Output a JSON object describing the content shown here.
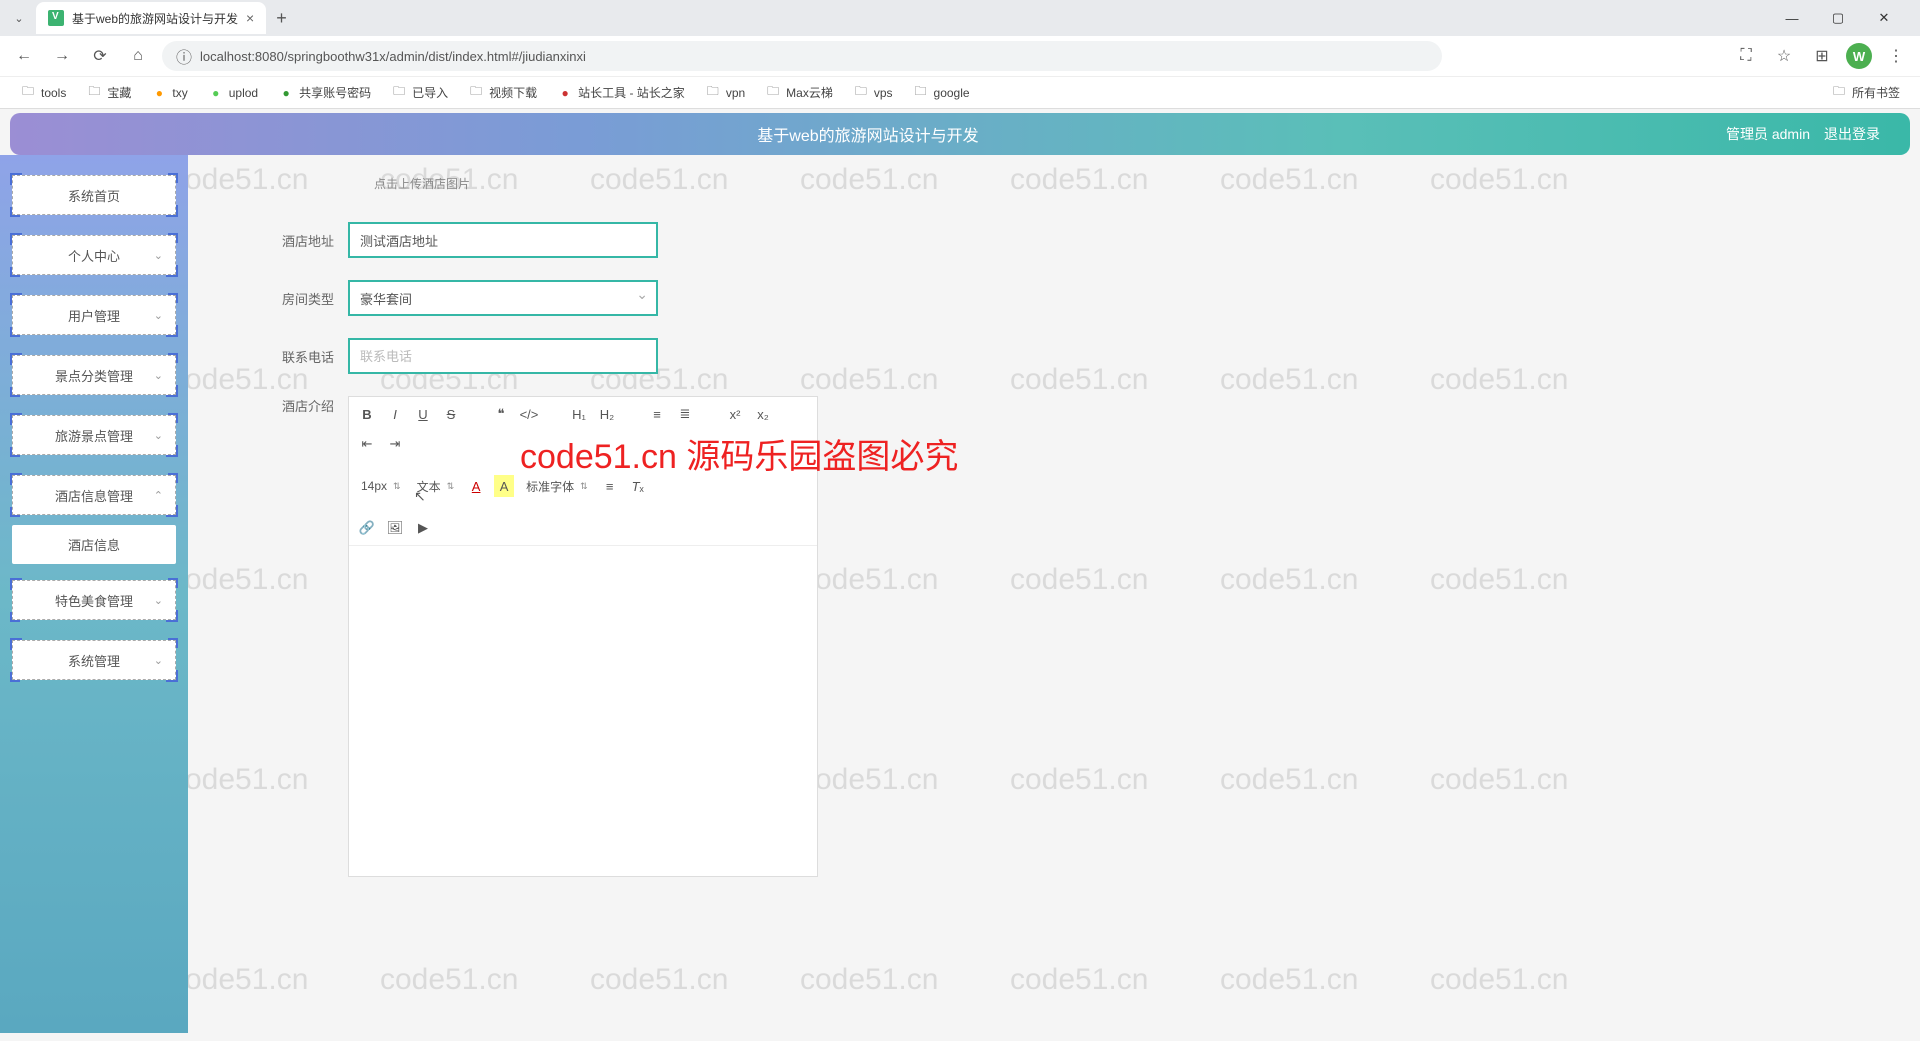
{
  "browser": {
    "tab_title": "基于web的旅游网站设计与开发",
    "url": "localhost:8080/springboothw31x/admin/dist/index.html#/jiudianxinxi",
    "avatar_letter": "W",
    "all_bookmarks": "所有书签"
  },
  "bookmarks": [
    {
      "label": "tools",
      "type": "folder"
    },
    {
      "label": "宝藏",
      "type": "folder"
    },
    {
      "label": "txy",
      "type": "link",
      "color": "#f90"
    },
    {
      "label": "uplod",
      "type": "link",
      "color": "#5c5"
    },
    {
      "label": "共享账号密码",
      "type": "link",
      "color": "#393"
    },
    {
      "label": "已导入",
      "type": "folder"
    },
    {
      "label": "视频下载",
      "type": "folder"
    },
    {
      "label": "站长工具 - 站长之家",
      "type": "link",
      "color": "#c33"
    },
    {
      "label": "vpn",
      "type": "folder"
    },
    {
      "label": "Max云梯",
      "type": "folder"
    },
    {
      "label": "vps",
      "type": "folder"
    },
    {
      "label": "google",
      "type": "folder"
    }
  ],
  "header": {
    "title": "基于web的旅游网站设计与开发",
    "user_role": "管理员 admin",
    "logout": "退出登录"
  },
  "sidebar": {
    "items": [
      {
        "label": "系统首页",
        "expandable": false
      },
      {
        "label": "个人中心",
        "expandable": true
      },
      {
        "label": "用户管理",
        "expandable": true
      },
      {
        "label": "景点分类管理",
        "expandable": true
      },
      {
        "label": "旅游景点管理",
        "expandable": true
      },
      {
        "label": "酒店信息管理",
        "expandable": true,
        "expanded": true
      },
      {
        "label": "特色美食管理",
        "expandable": true
      },
      {
        "label": "系统管理",
        "expandable": true
      }
    ],
    "submenu_active": "酒店信息"
  },
  "form": {
    "upload_hint": "点击上传酒店图片",
    "fields": {
      "address": {
        "label": "酒店地址",
        "value": "测试酒店地址"
      },
      "room_type": {
        "label": "房间类型",
        "value": "豪华套间"
      },
      "phone": {
        "label": "联系电话",
        "placeholder": "联系电话",
        "value": ""
      },
      "intro": {
        "label": "酒店介绍"
      }
    },
    "editor": {
      "font_size": "14px",
      "style_label": "文本",
      "font_family": "标准字体"
    }
  },
  "watermark": "code51.cn",
  "overlay": "code51.cn 源码乐园盗图必究"
}
